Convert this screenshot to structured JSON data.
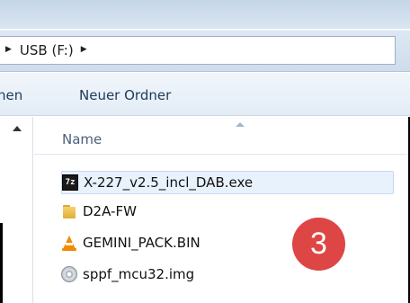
{
  "address": {
    "path": "USB (F:)"
  },
  "toolbar": {
    "partial_left_label": "nen",
    "new_folder_label": "Neuer Ordner"
  },
  "columns": {
    "name": "Name"
  },
  "files": [
    {
      "name": "X-227_v2.5_incl_DAB.exe",
      "icon": "7zip-icon",
      "selected": true
    },
    {
      "name": "D2A-FW",
      "icon": "folder-icon"
    },
    {
      "name": "GEMINI_PACK.BIN",
      "icon": "vlc-icon"
    },
    {
      "name": "sppf_mcu32.img",
      "icon": "disc-image-icon"
    }
  ],
  "badge": {
    "number": "3",
    "color": "#de4545"
  }
}
